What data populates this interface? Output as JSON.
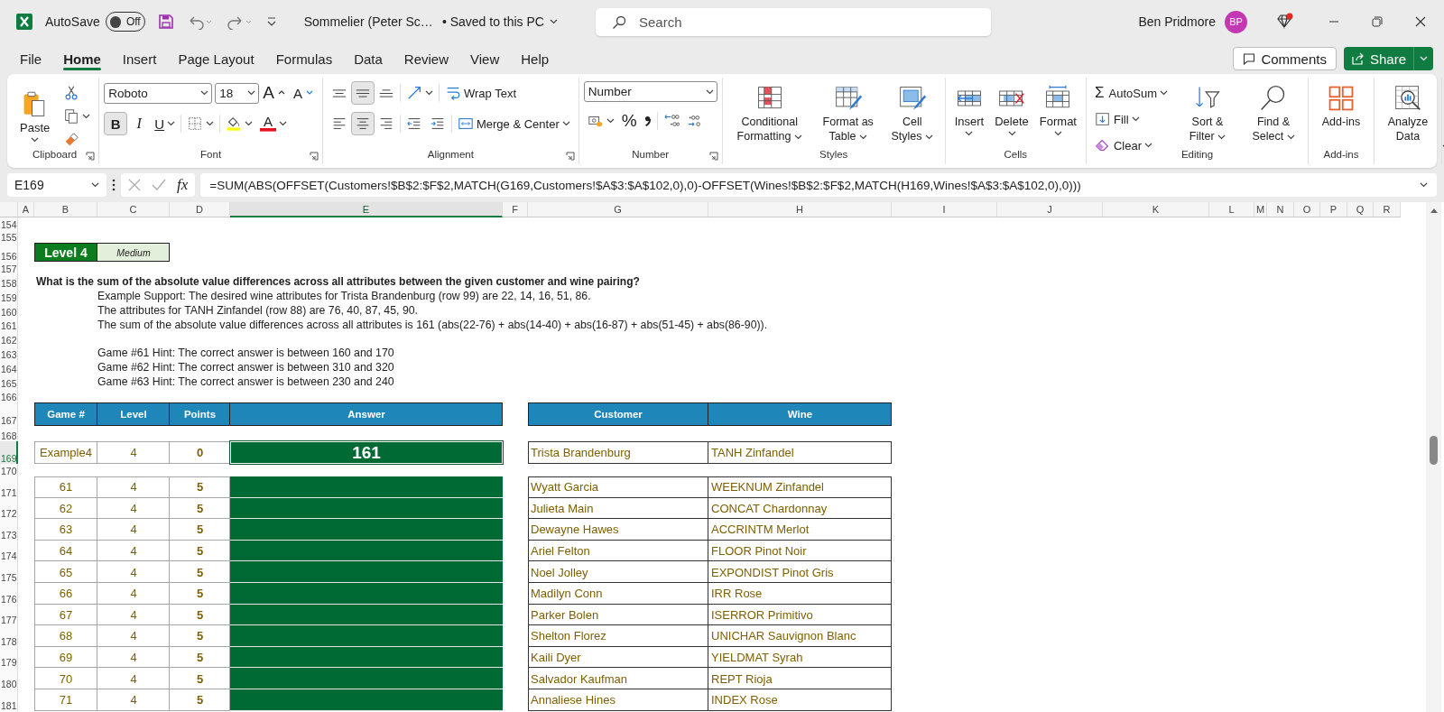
{
  "title_bar": {
    "autosave_label": "AutoSave",
    "autosave": {
      "on": false,
      "label": "Off"
    },
    "document_title": "Sommelier (Peter Sc…",
    "save_status": "• Saved to this PC",
    "search": {
      "placeholder": "Search"
    },
    "user_name": "Ben Pridmore",
    "avatar_initials": "BP"
  },
  "menu_tabs": [
    {
      "label": "File",
      "selected": false
    },
    {
      "label": "Home",
      "selected": true
    },
    {
      "label": "Insert",
      "selected": false
    },
    {
      "label": "Page Layout",
      "selected": false
    },
    {
      "label": "Formulas",
      "selected": false
    },
    {
      "label": "Data",
      "selected": false
    },
    {
      "label": "Review",
      "selected": false
    },
    {
      "label": "View",
      "selected": false
    },
    {
      "label": "Help",
      "selected": false
    }
  ],
  "share_bar": {
    "comments": "Comments",
    "share": "Share"
  },
  "ribbon": [
    {
      "kind": "clipboard",
      "label": "Clipboard",
      "launcher": true,
      "commands": [
        {
          "kind": "paste",
          "label": "Paste"
        },
        {
          "kind": "cut"
        },
        {
          "kind": "copy"
        },
        {
          "kind": "format_painter"
        }
      ]
    },
    {
      "kind": "font",
      "label": "Font",
      "launcher": true,
      "font_name": "Roboto",
      "font_size": "18",
      "commands": [
        {
          "kind": "grow",
          "label": "A"
        },
        {
          "kind": "shrink",
          "label": "A"
        },
        {
          "kind": "bold",
          "label": "B",
          "selected": true
        },
        {
          "kind": "italic",
          "label": "I",
          "selected": false
        },
        {
          "kind": "underline",
          "label": "U",
          "selected": false
        },
        {
          "kind": "borders"
        },
        {
          "kind": "fill_color"
        },
        {
          "kind": "font_color",
          "label": "A"
        }
      ]
    },
    {
      "kind": "alignment",
      "label": "Alignment",
      "launcher": true,
      "commands": [
        {
          "kind": "align_top",
          "selected": false
        },
        {
          "kind": "align_middle",
          "selected": true
        },
        {
          "kind": "align_bottom",
          "selected": false
        },
        {
          "kind": "orientation"
        },
        {
          "kind": "wrap_text",
          "label": "Wrap Text"
        },
        {
          "kind": "align_left",
          "selected": false
        },
        {
          "kind": "align_center",
          "selected": true
        },
        {
          "kind": "align_right",
          "selected": false
        },
        {
          "kind": "outdent"
        },
        {
          "kind": "indent"
        },
        {
          "kind": "merge",
          "label": "Merge & Center"
        }
      ]
    },
    {
      "kind": "number",
      "label": "Number",
      "launcher": true,
      "format": "Number",
      "commands": [
        {
          "kind": "accounting"
        },
        {
          "kind": "percent",
          "label": "%"
        },
        {
          "kind": "comma"
        },
        {
          "kind": "increase_decimal"
        },
        {
          "kind": "decrease_decimal"
        }
      ]
    },
    {
      "kind": "styles",
      "label": "Styles",
      "commands": [
        {
          "kind": "conditional",
          "label": "Conditional Formatting"
        },
        {
          "kind": "table",
          "label": "Format as Table"
        },
        {
          "kind": "cell_styles",
          "label": "Cell Styles"
        }
      ]
    },
    {
      "kind": "cells",
      "label": "Cells",
      "commands": [
        {
          "kind": "insert",
          "label": "Insert"
        },
        {
          "kind": "delete",
          "label": "Delete"
        },
        {
          "kind": "format",
          "label": "Format"
        }
      ]
    },
    {
      "kind": "editing",
      "label": "Editing",
      "commands": [
        {
          "kind": "autosum",
          "label": "AutoSum",
          "glyph": "Σ"
        },
        {
          "kind": "fill",
          "label": "Fill"
        },
        {
          "kind": "clear",
          "label": "Clear"
        },
        {
          "kind": "sort",
          "label": "Sort & Filter"
        },
        {
          "kind": "find",
          "label": "Find & Select"
        }
      ]
    },
    {
      "kind": "addins",
      "label": "Add-ins",
      "commands": [
        {
          "kind": "addins",
          "label": "Add-ins"
        }
      ]
    },
    {
      "kind": "analyze",
      "commands": [
        {
          "kind": "analyze",
          "label": "Analyze Data"
        }
      ]
    }
  ],
  "formula_bar": {
    "name_box": "E169",
    "fx": "fx",
    "formula": "=SUM(ABS(OFFSET(Customers!$B$2:$F$2,MATCH(G169,Customers!$A$3:$A$102,0),0)-OFFSET(Wines!$B$2:$F$2,MATCH(H169,Wines!$A$3:$A$102,0),0)))"
  },
  "columns": [
    {
      "label": "A",
      "selected": false
    },
    {
      "label": "B",
      "selected": false
    },
    {
      "label": "C",
      "selected": false
    },
    {
      "label": "D",
      "selected": false
    },
    {
      "label": "E",
      "selected": true
    },
    {
      "label": "F",
      "selected": false
    },
    {
      "label": "G",
      "selected": false
    },
    {
      "label": "H",
      "selected": false
    },
    {
      "label": "I",
      "selected": false
    },
    {
      "label": "J",
      "selected": false
    },
    {
      "label": "K",
      "selected": false
    },
    {
      "label": "L",
      "selected": false
    },
    {
      "label": "M",
      "selected": false
    },
    {
      "label": "N",
      "selected": false
    },
    {
      "label": "O",
      "selected": false
    },
    {
      "label": "P",
      "selected": false
    },
    {
      "label": "Q",
      "selected": false
    },
    {
      "label": "R",
      "selected": false
    }
  ],
  "rows": [
    {
      "label": "154",
      "selected": false
    },
    {
      "label": "155",
      "selected": false
    },
    {
      "label": "156",
      "selected": false
    },
    {
      "label": "157",
      "selected": false
    },
    {
      "label": "158",
      "selected": false
    },
    {
      "label": "159",
      "selected": false
    },
    {
      "label": "160",
      "selected": false
    },
    {
      "label": "161",
      "selected": false
    },
    {
      "label": "162",
      "selected": false
    },
    {
      "label": "163",
      "selected": false
    },
    {
      "label": "164",
      "selected": false
    },
    {
      "label": "165",
      "selected": false
    },
    {
      "label": "166",
      "selected": false
    },
    {
      "label": "167",
      "selected": false
    },
    {
      "label": "168",
      "selected": false
    },
    {
      "label": "169",
      "selected": true
    },
    {
      "label": "170",
      "selected": false
    },
    {
      "label": "171",
      "selected": false
    },
    {
      "label": "172",
      "selected": false
    },
    {
      "label": "173",
      "selected": false
    },
    {
      "label": "174",
      "selected": false
    },
    {
      "label": "175",
      "selected": false
    },
    {
      "label": "176",
      "selected": false
    },
    {
      "label": "177",
      "selected": false
    },
    {
      "label": "178",
      "selected": false
    },
    {
      "label": "179",
      "selected": false
    },
    {
      "label": "180",
      "selected": false
    },
    {
      "label": "181",
      "selected": false
    }
  ],
  "sheet": {
    "level_badge": {
      "label": "Level 4",
      "difficulty": "Medium"
    },
    "question": "What is the sum of the absolute value differences across all attributes between the given customer and wine pairing?",
    "example_support": [
      "Example Support: The desired wine attributes for Trista Brandenburg (row 99) are 22, 14, 16, 51, 86.",
      "The attributes for TANH Zinfandel (row 88) are 76, 40, 87, 45, 90.",
      "The sum of the absolute value differences across all attributes is 161 (abs(22-76) + abs(14-40) + abs(16-87) + abs(51-45) + abs(86-90))."
    ],
    "hints": [
      "Game #61 Hint: The correct answer is between 160 and 170",
      "Game #62 Hint: The correct answer is between 310 and 320",
      "Game #63 Hint: The correct answer is between 230 and 240"
    ],
    "game_table": {
      "columns": [
        "Game #",
        "Level",
        "Points",
        "Answer"
      ],
      "rows": [
        {
          "kind": "example",
          "game": "Example4",
          "level": "4",
          "points": "0",
          "answer": "161",
          "selected": true
        },
        {
          "kind": "game",
          "game": "61",
          "level": "4",
          "points": "5",
          "selected": false
        },
        {
          "kind": "game",
          "game": "62",
          "level": "4",
          "points": "5",
          "selected": false
        },
        {
          "kind": "game",
          "game": "63",
          "level": "4",
          "points": "5",
          "selected": false
        },
        {
          "kind": "game",
          "game": "64",
          "level": "4",
          "points": "5",
          "selected": false
        },
        {
          "kind": "game",
          "game": "65",
          "level": "4",
          "points": "5",
          "selected": false
        },
        {
          "kind": "game",
          "game": "66",
          "level": "4",
          "points": "5",
          "selected": false
        },
        {
          "kind": "game",
          "game": "67",
          "level": "4",
          "points": "5",
          "selected": false
        },
        {
          "kind": "game",
          "game": "68",
          "level": "4",
          "points": "5",
          "selected": false
        },
        {
          "kind": "game",
          "game": "69",
          "level": "4",
          "points": "5",
          "selected": false
        },
        {
          "kind": "game",
          "game": "70",
          "level": "4",
          "points": "5",
          "selected": false
        },
        {
          "kind": "game",
          "game": "71",
          "level": "4",
          "points": "5",
          "selected": false
        }
      ]
    },
    "pairing_table": {
      "columns": [
        "Customer",
        "Wine"
      ],
      "rows": [
        {
          "customer": "Trista Brandenburg",
          "wine": "TANH Zinfandel"
        },
        {
          "customer": "Wyatt Garcia",
          "wine": "WEEKNUM Zinfandel"
        },
        {
          "customer": "Julieta Main",
          "wine": "CONCAT Chardonnay"
        },
        {
          "customer": "Dewayne Hawes",
          "wine": "ACCRINTM Merlot"
        },
        {
          "customer": "Ariel Felton",
          "wine": "FLOOR Pinot Noir"
        },
        {
          "customer": "Noel Jolley",
          "wine": "EXPONDIST Pinot Gris"
        },
        {
          "customer": "Madilyn Conn",
          "wine": "IRR Rose"
        },
        {
          "customer": "Parker Bolen",
          "wine": "ISERROR Primitivo"
        },
        {
          "customer": "Shelton Florez",
          "wine": "UNICHAR Sauvignon Blanc"
        },
        {
          "customer": "Kaili Dyer",
          "wine": "YIELDMAT Syrah"
        },
        {
          "customer": "Salvador Kaufman",
          "wine": "REPT Rioja"
        },
        {
          "customer": "Annaliese Hines",
          "wine": "INDEX Rose"
        }
      ]
    }
  }
}
